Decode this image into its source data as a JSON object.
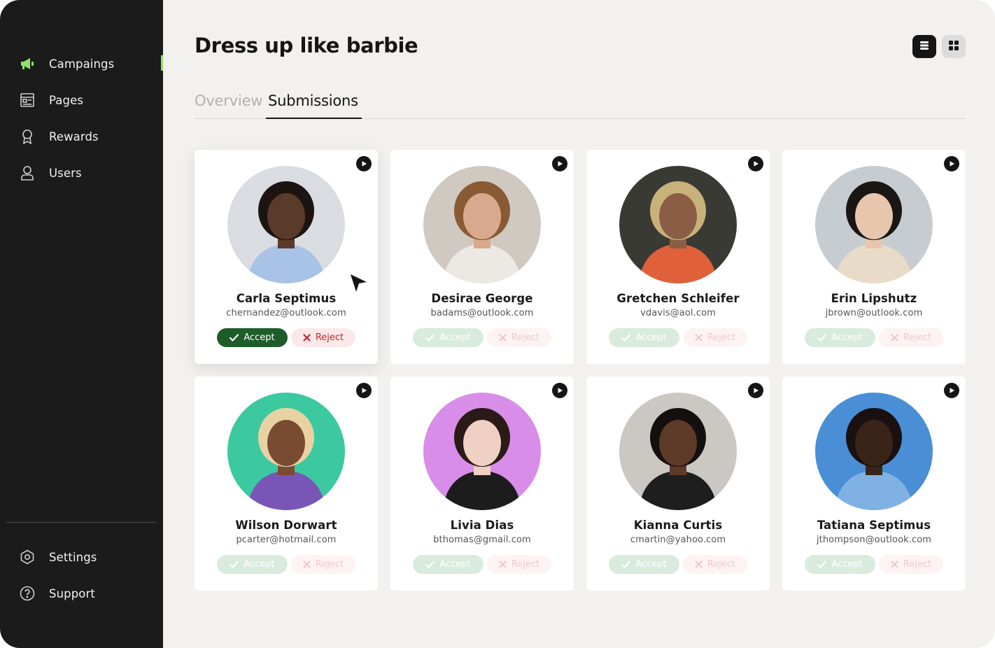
{
  "sidebar": {
    "nav": [
      {
        "label": "Campaings",
        "icon": "megaphone-icon",
        "active": true
      },
      {
        "label": "Pages",
        "icon": "page-icon"
      },
      {
        "label": "Rewards",
        "icon": "award-icon"
      },
      {
        "label": "Users",
        "icon": "user-icon"
      }
    ],
    "bottom": [
      {
        "label": "Settings",
        "icon": "settings-icon"
      },
      {
        "label": "Support",
        "icon": "help-icon"
      }
    ],
    "accent": "#8fe36a"
  },
  "header": {
    "title": "Dress up like barbie",
    "views": [
      {
        "icon": "list-view-icon",
        "active": true
      },
      {
        "icon": "grid-view-icon"
      }
    ]
  },
  "tabs": [
    {
      "label": "Overview"
    },
    {
      "label": "Submissions",
      "active": true
    }
  ],
  "actions": {
    "accept_label": "Accept",
    "reject_label": "Reject"
  },
  "submissions": [
    {
      "name": "Carla Septimus",
      "email": "chernandez@outlook.com",
      "focused": true,
      "bg": "#d9dde2",
      "skin": "#5a3a2a",
      "hair": "#1c1410",
      "shirt": "#a9c3e6"
    },
    {
      "name": "Desirae George",
      "email": "badams@outlook.com",
      "focused": false,
      "bg": "#cfc9c2",
      "skin": "#d9a98f",
      "hair": "#8a5a34",
      "shirt": "#ece9e4"
    },
    {
      "name": "Gretchen Schleifer",
      "email": "vdavis@aol.com",
      "focused": false,
      "bg": "#3a3a34",
      "skin": "#8a5e45",
      "hair": "#c9b27a",
      "shirt": "#e0603a"
    },
    {
      "name": "Erin Lipshutz",
      "email": "jbrown@outlook.com",
      "focused": false,
      "bg": "#c7ccd0",
      "skin": "#e8c6ae",
      "hair": "#1a1614",
      "shirt": "#e8dcc8"
    },
    {
      "name": "Wilson Dorwart",
      "email": "pcarter@hotmail.com",
      "focused": false,
      "bg": "#3cc9a0",
      "skin": "#7a4b33",
      "hair": "#e8d2a4",
      "shirt": "#7a55b8"
    },
    {
      "name": "Livia Dias",
      "email": "bthomas@gmail.com",
      "focused": false,
      "bg": "#d88ee8",
      "skin": "#efd0c2",
      "hair": "#2a1a18",
      "shirt": "#1c1c1c"
    },
    {
      "name": "Kianna Curtis",
      "email": "cmartin@yahoo.com",
      "focused": false,
      "bg": "#cbc7c3",
      "skin": "#5e3a28",
      "hair": "#141010",
      "shirt": "#1e1e1e"
    },
    {
      "name": "Tatiana Septimus",
      "email": "jthompson@outlook.com",
      "focused": false,
      "bg": "#4a8fd6",
      "skin": "#3a2418",
      "hair": "#1a1010",
      "shirt": "#7fb2e3"
    }
  ]
}
